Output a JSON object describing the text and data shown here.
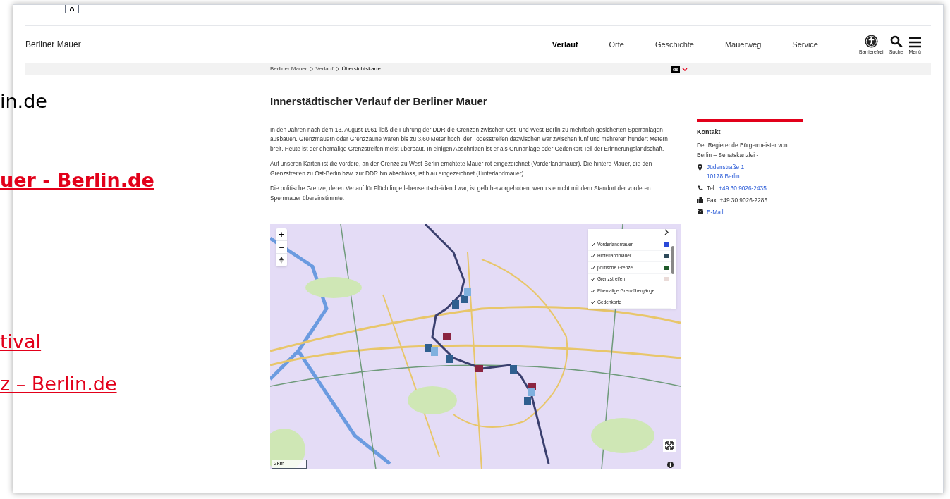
{
  "document_fragments": [
    {
      "text": "in.de",
      "kind": "plain"
    },
    {
      "text": "uer - Berlin.de",
      "kind": "bold_link"
    },
    {
      "text": "tival",
      "kind": "link"
    },
    {
      "text": "z – Berlin.de",
      "kind": "link"
    }
  ],
  "header": {
    "site_title": "Berliner Mauer",
    "nav": [
      {
        "label": "Verlauf",
        "selected": true
      },
      {
        "label": "Orte",
        "selected": false
      },
      {
        "label": "Geschichte",
        "selected": false
      },
      {
        "label": "Mauerweg",
        "selected": false
      },
      {
        "label": "Service",
        "selected": false
      }
    ],
    "tools": [
      {
        "kind": "accessibility",
        "label": "Barrierefrei"
      },
      {
        "kind": "search",
        "label": "Suche"
      },
      {
        "kind": "menu",
        "label": "Menü"
      }
    ]
  },
  "breadcrumb": [
    "Berliner Mauer",
    "Verlauf",
    "Übersichtskarte"
  ],
  "language": "de",
  "title": "Innerstädtischer Verlauf der Berliner Mauer",
  "paragraphs": [
    "In den Jahren nach dem 13. August 1961 ließ die Führung der DDR die Grenzen zwischen Ost- und West-Berlin zu mehrfach gesicherten Sperranlagen ausbauen. Grenzmauern oder Grenzzäune waren bis zu 3,60 Meter hoch, der Todesstreifen dazwischen war zwischen fünf und mehreren hundert Metern breit. Heute ist der ehemalige Grenzstreifen meist überbaut. In einigen Abschnitten ist er als Grünanlage oder Gedenkort Teil der Erinnerungslandschaft.",
    "Auf unseren Karten ist die vordere, an der Grenze zu West-Berlin errichtete Mauer rot eingezeichnet (Vorderlandmauer). Die hintere Mauer, die den Grenzstreifen zu Ost-Berlin bzw. zur DDR hin abschloss, ist blau eingezeichnet (Hinterlandmauer).",
    "Die politische Grenze, deren Verlauf für Flüchtlinge lebensentscheidend war, ist gelb hervorgehoben, wenn sie nicht mit dem Standort der vorderen Sperrmauer übereinstimmte."
  ],
  "contact": {
    "heading": "Kontakt",
    "organisation": "Der Regierende Bürgermeister von Berlin – Senatskanzlei -",
    "items": [
      {
        "kind": "address",
        "lines": [
          "Jüdenstraße 1",
          "10178 Berlin"
        ]
      },
      {
        "kind": "phone",
        "label": "Tel.:",
        "value": "+49 30 9026-2435"
      },
      {
        "kind": "fax",
        "label": "Fax:",
        "value": "+49 30 9026-2285"
      },
      {
        "kind": "email",
        "value": "E-Mail"
      }
    ]
  },
  "map": {
    "zoom_controls": [
      "+",
      "−"
    ],
    "legend": [
      {
        "label": "Vorderlandmauer",
        "checked": true,
        "color": "#2a49d8"
      },
      {
        "label": "Hinterlandmauer",
        "checked": true,
        "color": "#2e4a5a"
      },
      {
        "label": "politische Grenze",
        "checked": true,
        "color": "#1f5a2a"
      },
      {
        "label": "Grenzstreifen",
        "checked": true,
        "color": "#eadbd8"
      },
      {
        "label": "Ehemalige Grenzübergänge",
        "checked": true
      },
      {
        "label": "Gedenkorte",
        "checked": true
      }
    ],
    "scale": "2km"
  }
}
